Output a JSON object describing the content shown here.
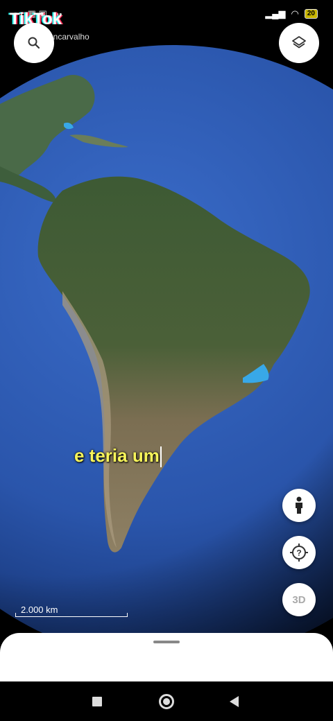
{
  "status_bar": {
    "battery": "20",
    "more": "•••"
  },
  "watermark": {
    "brand": "TikTok",
    "username": "ancarvalho"
  },
  "caption": {
    "text": "e teria um"
  },
  "scale": {
    "label": "2.000 km"
  },
  "buttons": {
    "three_d_label": "3D"
  },
  "colors": {
    "ocean": "#2f5fb8",
    "land_green": "#3f5a35",
    "land_brown": "#8b7a58",
    "caption": "#f7f45a",
    "highlight": "#38a8e8"
  }
}
